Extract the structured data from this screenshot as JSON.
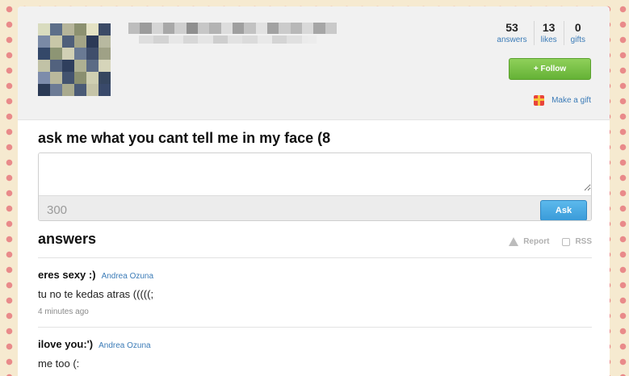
{
  "stats": [
    {
      "value": "53",
      "label": "answers"
    },
    {
      "value": "13",
      "label": "likes"
    },
    {
      "value": "0",
      "label": "gifts"
    }
  ],
  "follow_label": "+ Follow",
  "gift_label": "Make a gift",
  "title": "ask me what you cant tell me in my face (8",
  "ask": {
    "value": "",
    "char_count": "300",
    "button": "Ask"
  },
  "answers_heading": "answers",
  "tools": {
    "report": "Report",
    "rss": "RSS"
  },
  "answers": [
    {
      "question": "eres sexy :)",
      "author": "Andrea Ozuna",
      "text": "tu no te kedas atras (((((;",
      "time": "4 minutes ago"
    },
    {
      "question": "ilove you:')",
      "author": "Andrea Ozuna",
      "text": "me too (:"
    }
  ],
  "colors": {
    "follow": "#65b236",
    "ask": "#3a9bd9",
    "link": "#3b7bb7"
  }
}
